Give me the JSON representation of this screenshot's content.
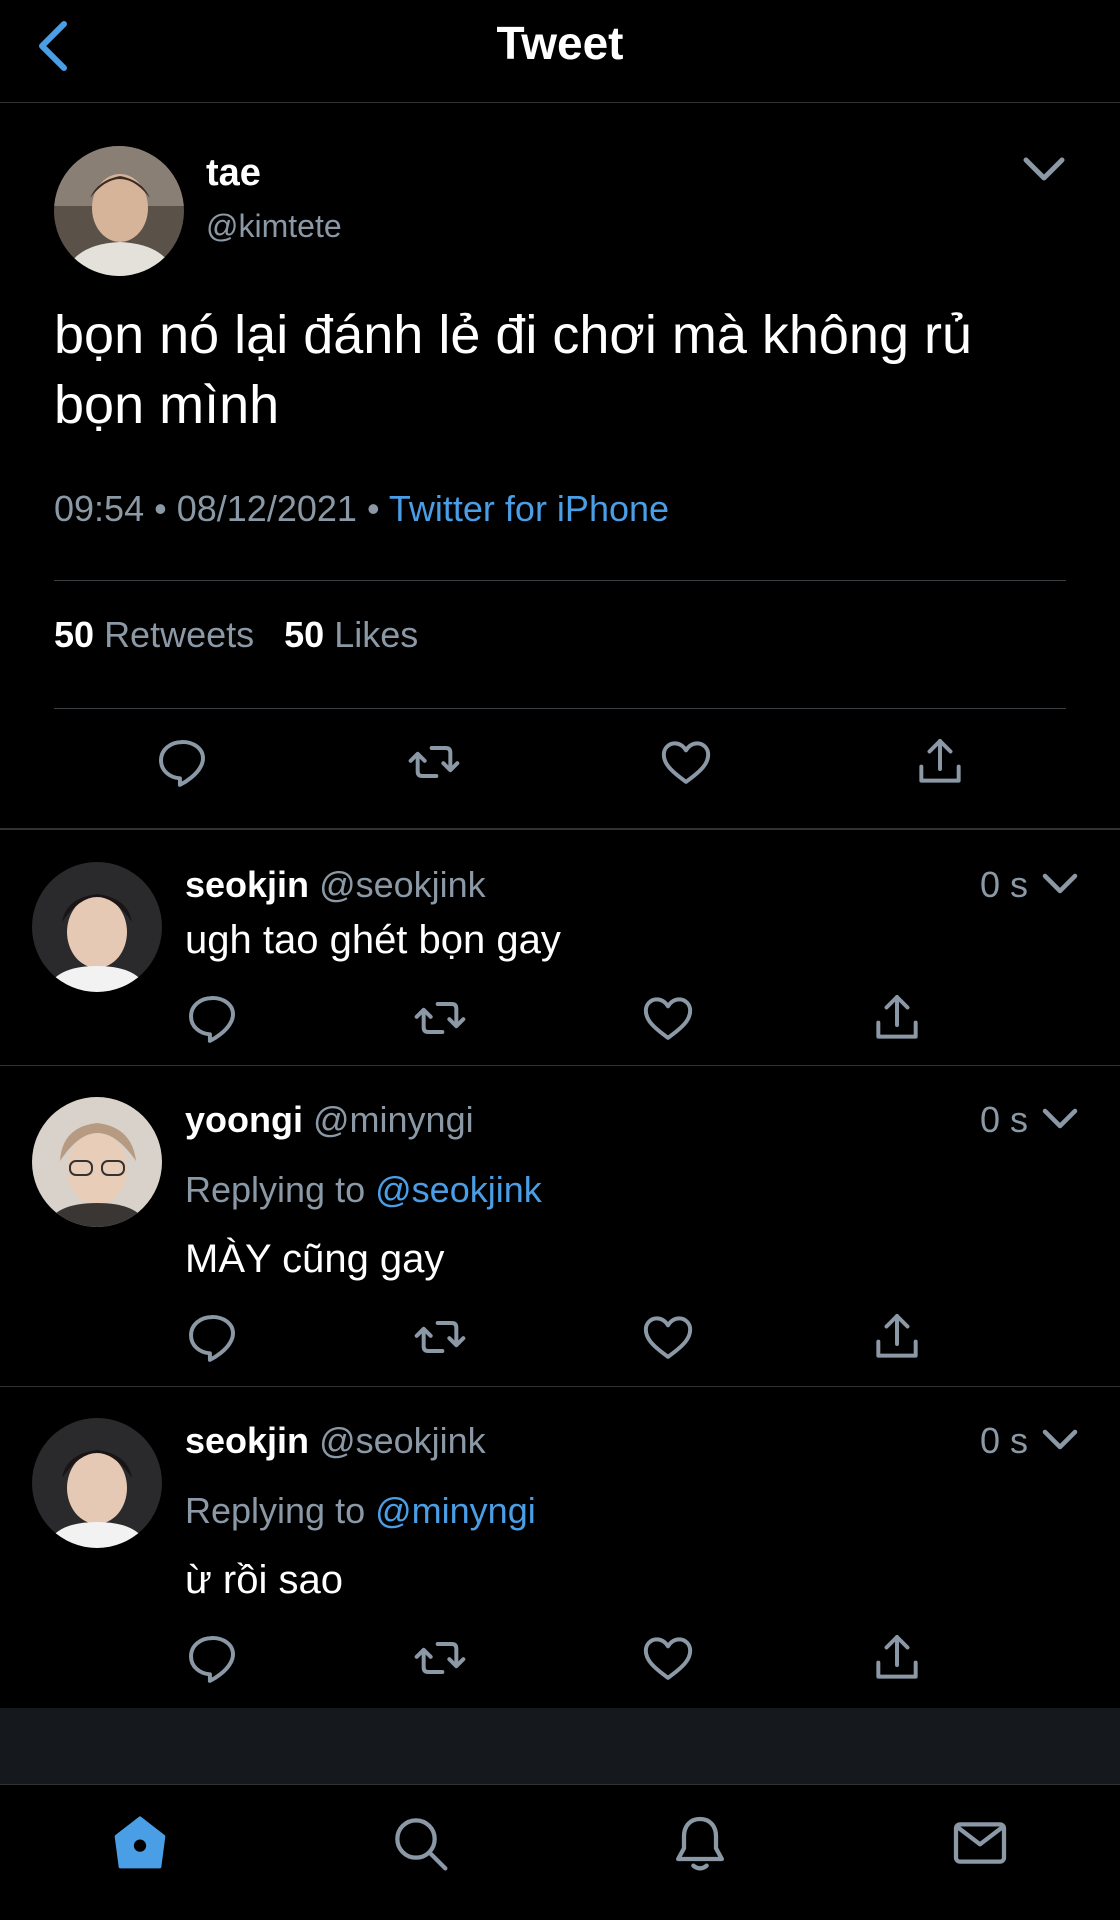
{
  "header": {
    "title": "Tweet"
  },
  "main_tweet": {
    "name": "tae",
    "handle": "@kimtete",
    "text": "bọn nó lại đánh lẻ đi chơi mà không rủ bọn mình",
    "time": "09:54",
    "date": "08/12/2021",
    "separator": "•",
    "source": "Twitter for iPhone",
    "retweets_count": "50",
    "retweets_label": "Retweets",
    "likes_count": "50",
    "likes_label": "Likes"
  },
  "replies": [
    {
      "name": "seokjin",
      "handle": "@seokjink",
      "time": "0 s",
      "replying_prefix": "",
      "replying_to": "",
      "text": "ugh tao ghét bọn gay"
    },
    {
      "name": "yoongi",
      "handle": "@minyngi",
      "time": "0 s",
      "replying_prefix": "Replying to",
      "replying_to": "@seokjink",
      "text": "MÀY cũng gay"
    },
    {
      "name": "seokjin",
      "handle": "@seokjink",
      "time": "0 s",
      "replying_prefix": "Replying to",
      "replying_to": "@minyngi",
      "text": "ừ rồi sao"
    }
  ],
  "icons": {
    "back": "chevron-left-icon",
    "caret": "chevron-down-icon",
    "reply": "reply-icon",
    "retweet": "retweet-icon",
    "like": "heart-icon",
    "share": "share-icon",
    "home": "home-icon",
    "search": "search-icon",
    "notifications": "bell-icon",
    "messages": "mail-icon"
  },
  "colors": {
    "background": "#000000",
    "accent": "#4a9ee6",
    "secondary_text": "#8b98a5",
    "icon": "#8b98a5"
  }
}
